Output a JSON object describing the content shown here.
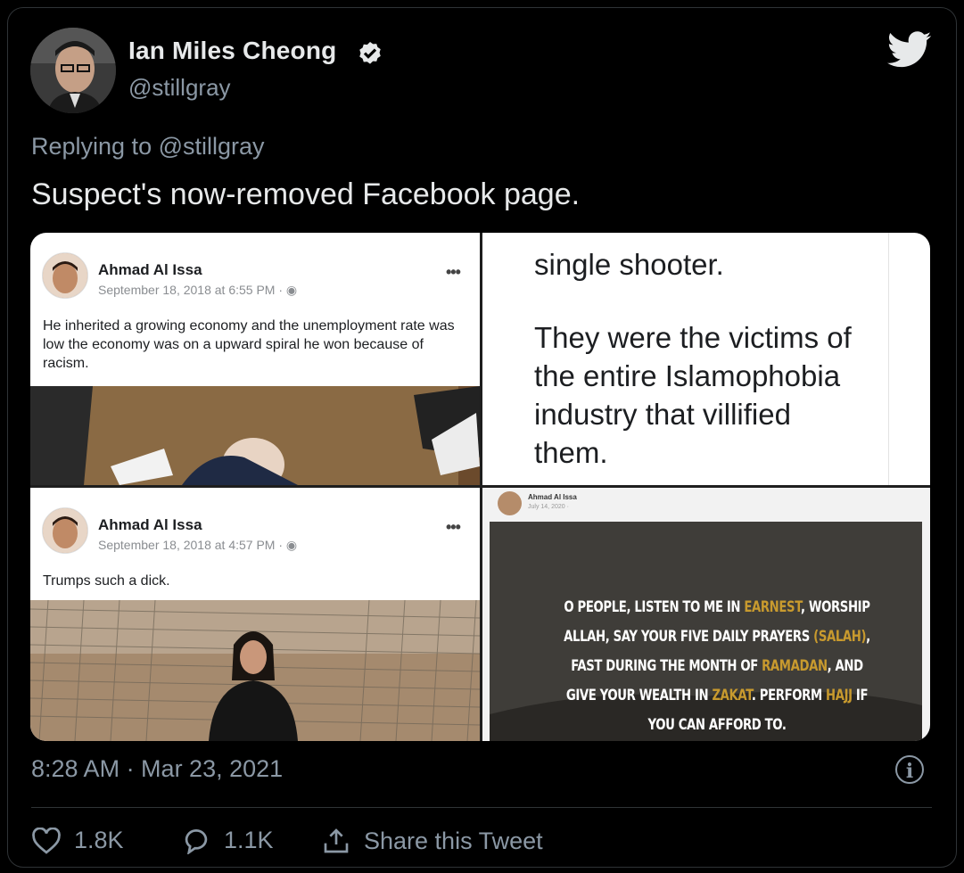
{
  "author": {
    "name": "Ian Miles Cheong",
    "handle": "@stillgray",
    "verified": true
  },
  "icons": {
    "verified": "verified-badge-icon",
    "bird": "twitter-bird-icon",
    "info": "info-icon",
    "like": "heart-icon",
    "reply": "reply-bubble-icon",
    "share": "share-icon"
  },
  "replying_to": "Replying to @stillgray",
  "tweet_text": "Suspect's now-removed Facebook page.",
  "media": {
    "post1": {
      "name": "Ahmad Al Issa",
      "date": "September 18, 2018 at 6:55 PM · ",
      "text": "He inherited a growing economy and the unemployment rate was low the economy was on a upward spiral he won because of racism."
    },
    "post2": {
      "line1": "single shooter.",
      "line2": "They were the victims of",
      "line3": "the entire Islamophobia",
      "line4": "industry that villified",
      "line5": "them."
    },
    "post3": {
      "name": "Ahmad Al Issa",
      "date": "September 18, 2018 at 4:57 PM · ",
      "text": "Trumps such a dick."
    },
    "post4": {
      "name": "Ahmad Al Issa",
      "date": "July 14, 2020 · ",
      "quote_a": "O PEOPLE, LISTEN TO ME IN ",
      "quote_b": "EARNEST",
      "quote_c": ", WORSHIP ALLAH, SAY YOUR FIVE DAILY PRAYERS ",
      "quote_d": "(SALAH)",
      "quote_e": ", FAST DURING THE MONTH OF ",
      "quote_f": "RAMADAN",
      "quote_g": ", AND GIVE YOUR WEALTH IN ",
      "quote_h": "ZAKAT",
      "quote_i": ". PERFORM ",
      "quote_j": "HAJJ",
      "quote_k": " IF YOU CAN AFFORD TO."
    }
  },
  "timestamp": "8:28 AM · Mar 23, 2021",
  "stats": {
    "likes": "1.8K",
    "replies": "1.1K",
    "share_label": "Share this Tweet"
  },
  "colors": {
    "background": "#000000",
    "secondary_text": "#8b98a5",
    "primary_text": "#e7e9ea",
    "highlight": "#c89a2e"
  }
}
